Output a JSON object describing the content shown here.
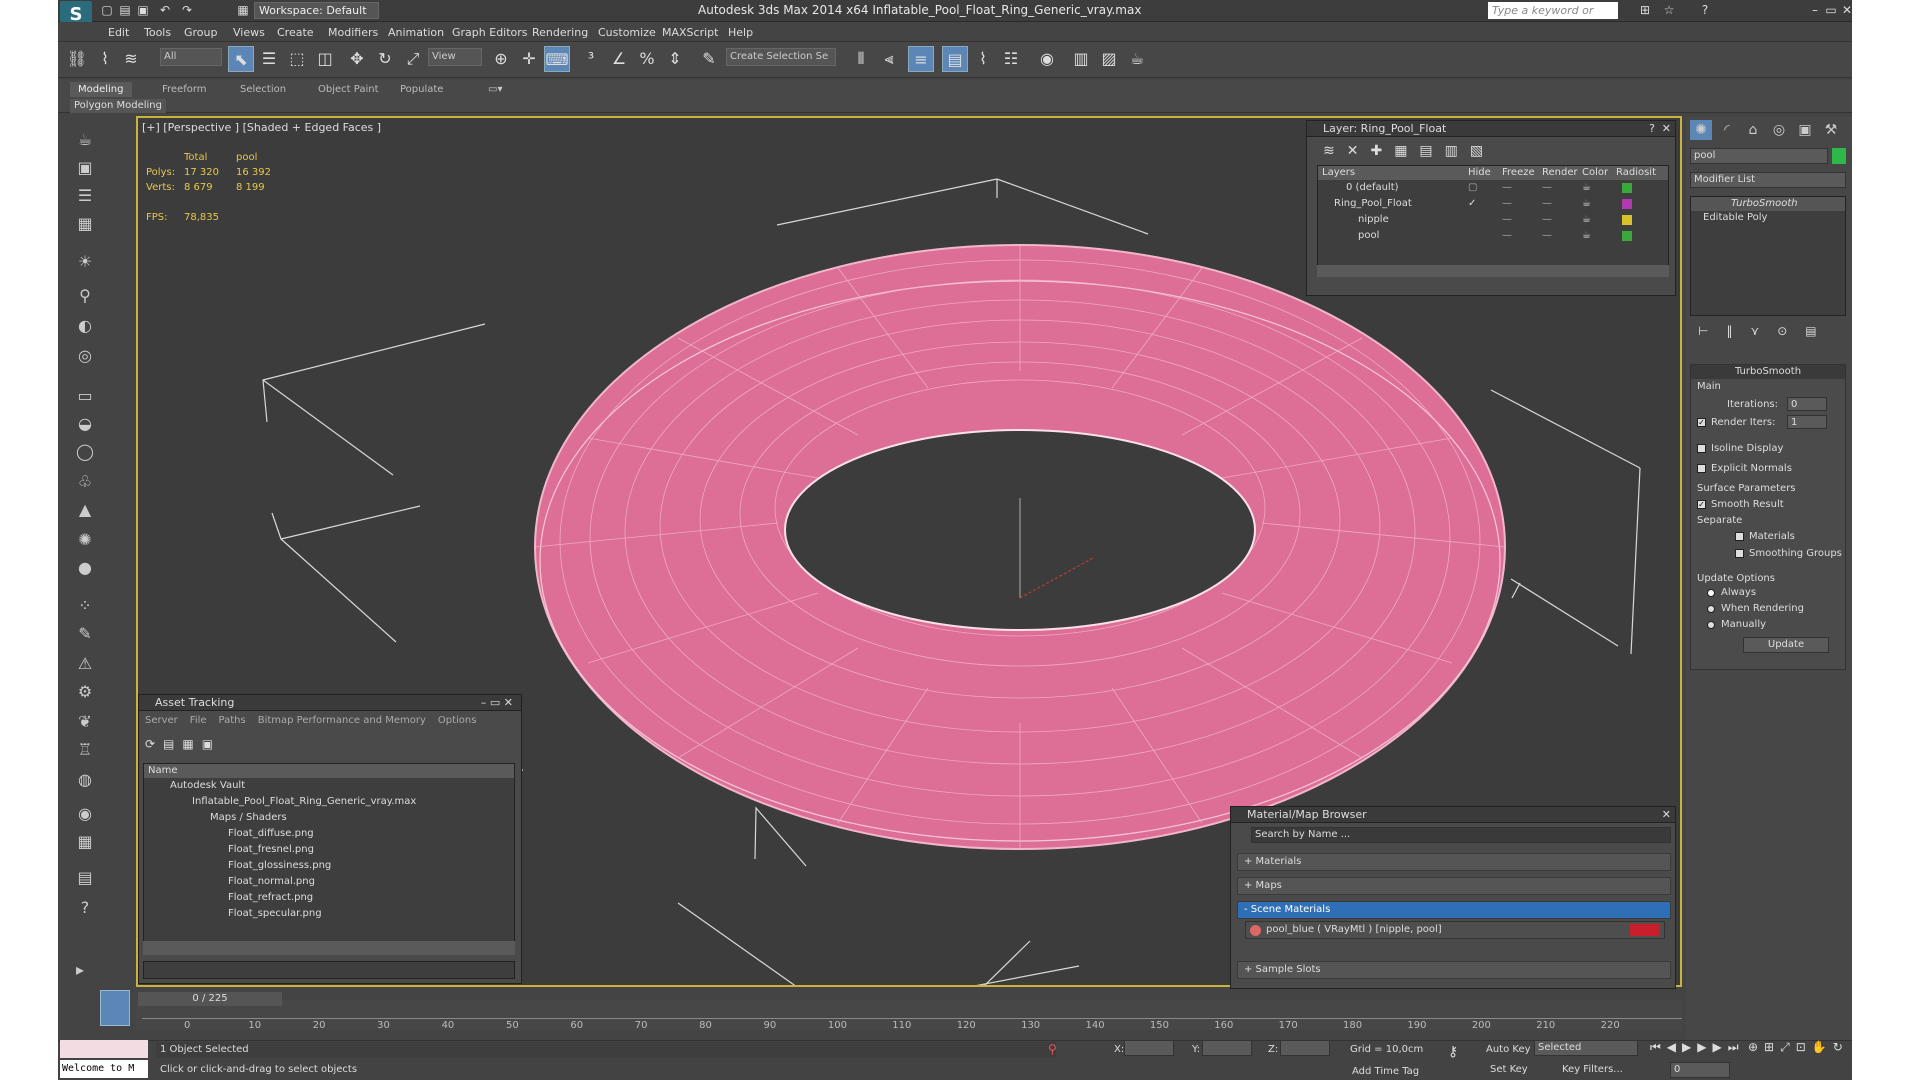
{
  "title": "Autodesk 3ds Max  2014 x64      Inflatable_Pool_Float_Ring_Generic_vray.max",
  "workspace": "Workspace: Default",
  "search": {
    "placeholder": "Type a keyword or phrase"
  },
  "menu": [
    "Edit",
    "Tools",
    "Group",
    "Views",
    "Create",
    "Modifiers",
    "Animation",
    "Graph Editors",
    "Rendering",
    "Customize",
    "MAXScript",
    "Help"
  ],
  "toolbar": {
    "filter": "All",
    "refcoord": "View",
    "selection_set": "Create Selection Se"
  },
  "ribbon": {
    "tabs": [
      "Modeling",
      "Freeform",
      "Selection",
      "Object Paint",
      "Populate"
    ],
    "sub": "Polygon Modeling"
  },
  "viewport": {
    "label": "[+] [Perspective ] [Shaded + Edged Faces ]",
    "stats": {
      "col_total": "Total",
      "col_obj": "pool",
      "polys_label": "Polys:",
      "polys_total": "17 320",
      "polys_obj": "16 392",
      "verts_label": "Verts:",
      "verts_total": "8 679",
      "verts_obj": "8 199",
      "fps_label": "FPS:",
      "fps": "78,835"
    }
  },
  "layer_panel": {
    "title": "Layer: Ring_Pool_Float",
    "cols": [
      "Layers",
      "Hide",
      "Freeze",
      "Render",
      "Color",
      "Radiosit"
    ],
    "rows": [
      {
        "name": "0 (default)",
        "color": "#3aa83a"
      },
      {
        "name": "Ring_Pool_Float",
        "color": "#b13ab1"
      },
      {
        "name": "nipple",
        "color": "#d8c22c"
      },
      {
        "name": "pool",
        "color": "#3aa83a"
      }
    ]
  },
  "asset_panel": {
    "title": "Asset Tracking",
    "menu": [
      "Server",
      "File",
      "Paths",
      "Bitmap Performance and Memory",
      "Options"
    ],
    "col": "Name",
    "items": [
      "Autodesk Vault",
      "Inflatable_Pool_Float_Ring_Generic_vray.max",
      "Maps / Shaders",
      "Float_diffuse.png",
      "Float_fresnel.png",
      "Float_glossiness.png",
      "Float_normal.png",
      "Float_refract.png",
      "Float_specular.png"
    ]
  },
  "material_panel": {
    "title": "Material/Map Browser",
    "search": "Search by Name ...",
    "rows": [
      "+ Materials",
      "+ Maps",
      "- Scene Materials",
      "+ Sample Slots"
    ],
    "material": "pool_blue  ( VRayMtl ) [nipple, pool]"
  },
  "command_panel": {
    "object_name": "pool",
    "modifier_list": "Modifier List",
    "stack": [
      "TurboSmooth",
      "Editable Poly"
    ],
    "rollout": "TurboSmooth",
    "main": "Main",
    "iterations_label": "Iterations:",
    "iterations": "0",
    "render_iters_label": "Render Iters:",
    "render_iters": "1",
    "isoline": "Isoline Display",
    "explicit": "Explicit Normals",
    "surface": "Surface Parameters",
    "smooth": "Smooth Result",
    "separate": "Separate",
    "materials": "Materials",
    "smoothing": "Smoothing Groups",
    "update_options": "Update Options",
    "always": "Always",
    "when_rendering": "When Rendering",
    "manually": "Manually",
    "update": "Update"
  },
  "timeline": {
    "frame": "0 / 225",
    "ticks": [
      "0",
      "10",
      "20",
      "30",
      "40",
      "50",
      "60",
      "70",
      "80",
      "90",
      "100",
      "110",
      "120",
      "130",
      "140",
      "150",
      "160",
      "170",
      "180",
      "190",
      "200",
      "210",
      "220"
    ]
  },
  "status": {
    "welcome": "Welcome to M",
    "selected": "1 Object Selected",
    "prompt": "Click or click-and-drag to select objects",
    "x": "X:",
    "y": "Y:",
    "z": "Z:",
    "grid": "Grid = 10,0cm",
    "add_time_tag": "Add Time Tag",
    "auto_key": "Auto Key",
    "set_key": "Set Key",
    "selected_dd": "Selected",
    "key_filters": "Key Filters...",
    "frame_field": "0"
  }
}
